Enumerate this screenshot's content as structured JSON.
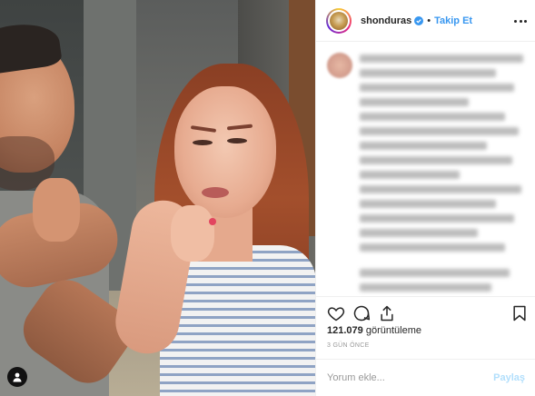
{
  "post": {
    "username": "shonduras",
    "separator": "•",
    "follow_label": "Takip Et",
    "views_count": "121.079",
    "views_label": "görüntüleme",
    "timestamp": "3 GÜN ÖNCE",
    "comment_placeholder": "Yorum ekle...",
    "share_label": "Paylaş"
  },
  "colors": {
    "accent": "#3897f0",
    "share_disabled": "#b2dffc",
    "divider": "#efefef"
  },
  "icons": [
    "heart-icon",
    "comment-icon",
    "share-icon",
    "bookmark-icon",
    "more-options-icon",
    "verified-badge-icon",
    "user-account-icon"
  ]
}
